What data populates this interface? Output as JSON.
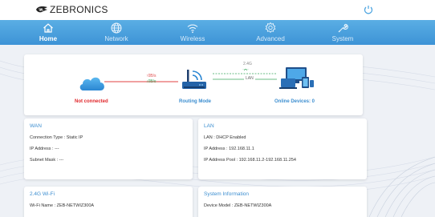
{
  "header": {
    "brand": "ZEBRONICS"
  },
  "nav": {
    "items": [
      {
        "label": "Home",
        "icon": "home-icon",
        "active": true
      },
      {
        "label": "Network",
        "icon": "globe-icon",
        "active": false
      },
      {
        "label": "Wireless",
        "icon": "wifi-icon",
        "active": false
      },
      {
        "label": "Advanced",
        "icon": "gear-icon",
        "active": false
      },
      {
        "label": "System",
        "icon": "wrench-icon",
        "active": false
      }
    ]
  },
  "status": {
    "internet": "Not connected",
    "mode": "Routing Mode",
    "devices": "Online Devices: 0",
    "upload": "↑0B/s",
    "download": "↓0B/s",
    "band": "2.4G",
    "lan_label": "LAN"
  },
  "wan": {
    "title": "WAN",
    "connection_type": "Connection Type : Static IP",
    "ip": "IP Address : ---",
    "mask": "Subnet Mask : ---"
  },
  "lan": {
    "title": "LAN",
    "dhcp": "LAN : DHCP Enabled",
    "ip": "IP Address : 192.168.11.1",
    "pool": "IP Address Pool : 192.168.11.2-192.168.11.254"
  },
  "wifi": {
    "title": "2.4G Wi-Fi",
    "name": "Wi-Fi Name : ZEB-NETWIZ300A"
  },
  "system": {
    "title": "System Information",
    "model": "Device Model : ZEB-NETWIZ300A"
  },
  "colors": {
    "nav": "#4aa3e0",
    "accent": "#3c8ed0",
    "error": "#e0262a"
  }
}
